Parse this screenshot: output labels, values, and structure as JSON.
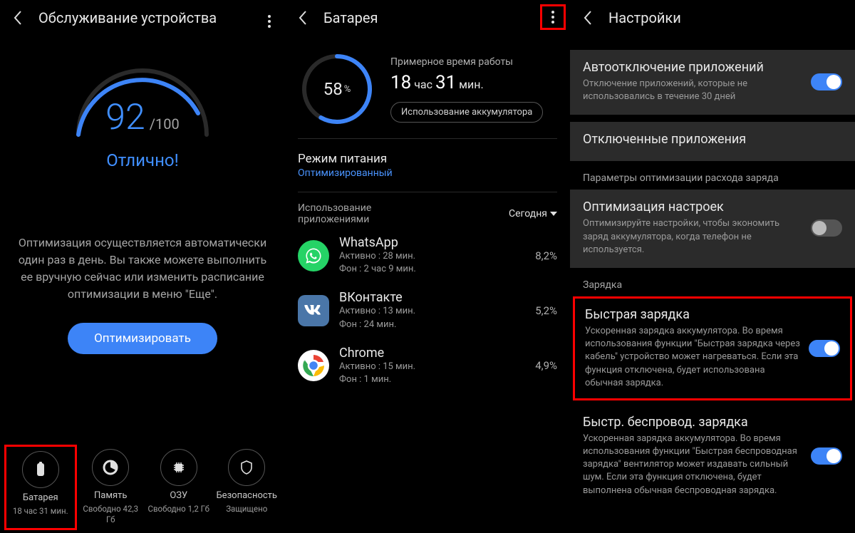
{
  "panel1": {
    "title": "Обслуживание устройства",
    "score": "92",
    "score_max": "/100",
    "score_label": "Отлично!",
    "desc": "Оптимизация осуществляется автоматически один раз в день. Вы также можете выполнить ее вручную сейчас или изменить расписание оптимизации в меню \"Еще\".",
    "optimize": "Оптимизировать",
    "stats": [
      {
        "label": "Батарея",
        "sub": "18 час 31 мин."
      },
      {
        "label": "Память",
        "sub": "Свободно 42,3 Гб"
      },
      {
        "label": "ОЗУ",
        "sub": "Свободно 1,2 Гб"
      },
      {
        "label": "Безопасность",
        "sub": "Защищено"
      }
    ]
  },
  "panel2": {
    "title": "Батарея",
    "pct": "58",
    "pct_unit": "%",
    "est_label": "Примерное время работы",
    "est_h": "18",
    "est_h_u": "час",
    "est_m": "31",
    "est_m_u": "мин.",
    "usage_btn": "Использование аккумулятора",
    "mode_title": "Режим питания",
    "mode_sub": "Оптимизированный",
    "usage_head_l": "Использование приложениями",
    "usage_head_r": "Сегодня",
    "apps": [
      {
        "name": "WhatsApp",
        "active": "Активно : 28 мин.",
        "bg": "Фон : 2 час 9 мин.",
        "pct": "8,2%"
      },
      {
        "name": "ВКонтакте",
        "active": "Активно : 13 мин.",
        "bg": "Фон : 24 мин.",
        "pct": "5,2%"
      },
      {
        "name": "Chrome",
        "active": "Активно : 15 мин.",
        "bg": "Фон : 1 мин.",
        "pct": "4,9%"
      }
    ]
  },
  "panel3": {
    "title": "Настройки",
    "auto_off_t": "Автоотключение приложений",
    "auto_off_d": "Отключение приложений, которые не использовались в течение 30 дней",
    "disabled_apps": "Отключенные приложения",
    "group1": "Параметры оптимизации расхода заряда",
    "opt_t": "Оптимизация настроек",
    "opt_d": "Оптимизируйте настройки, чтобы экономить заряд аккумулятора, когда телефон не используется.",
    "group2": "Зарядка",
    "fast_t": "Быстрая зарядка",
    "fast_d": "Ускоренная зарядка аккумулятора. Во время использования функции \"Быстрая зарядка через кабель\" устройство может нагреваться. Если эта функция отключена, будет использована обычная зарядка.",
    "wfast_t": "Быстр. беспровод. зарядка",
    "wfast_d": "Ускоренная зарядка аккумулятора. Во время использования функции \"Быстрая беспроводная зарядка\" вентилятор может издавать сильный шум. Если эта функция отключена, будет выполнена обычная беспроводная зарядка."
  }
}
